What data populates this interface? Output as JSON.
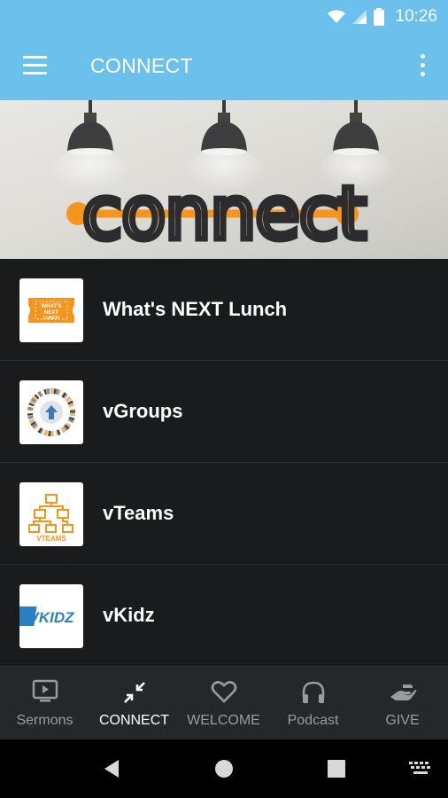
{
  "status_bar": {
    "time": "10:26"
  },
  "app_bar": {
    "title": "CONNECT"
  },
  "banner": {
    "word": "connect"
  },
  "list_items": [
    {
      "label": "What's NEXT Lunch",
      "thumb_lines": [
        "WHAT'S",
        "NEXT",
        "LUNCH"
      ]
    },
    {
      "label": "vGroups"
    },
    {
      "label": "vTeams",
      "thumb_text": "VTEAMS"
    },
    {
      "label": "vKidz",
      "thumb_text": "VKIDZ"
    }
  ],
  "bottom_nav": [
    {
      "label": "Sermons",
      "icon": "tv-play-icon",
      "active": false
    },
    {
      "label": "CONNECT",
      "icon": "compress-arrows-icon",
      "active": true
    },
    {
      "label": "WELCOME",
      "icon": "heart-outline-icon",
      "active": false
    },
    {
      "label": "Podcast",
      "icon": "headphones-icon",
      "active": false
    },
    {
      "label": "GIVE",
      "icon": "hand-give-icon",
      "active": false
    }
  ],
  "colors": {
    "app_bar": "#6cc0ec",
    "list_background": "#1a1b1d",
    "bottom_nav": "#26272b",
    "accent_orange": "#f7941d"
  }
}
